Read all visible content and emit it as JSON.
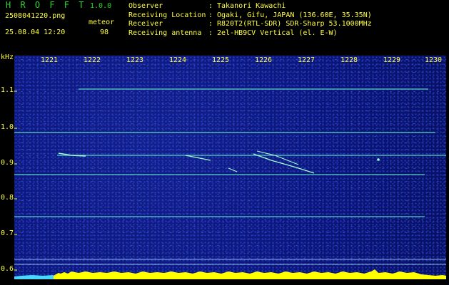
{
  "app": {
    "logo": "H R O F F T",
    "version": "1.0.0",
    "filename": "2508041220.png",
    "meteor_label": "meteor",
    "datetime": "25.08.04 12:20",
    "meteor_count": "98"
  },
  "info": [
    {
      "key": "Observer",
      "value": "Takanori Kawachi"
    },
    {
      "key": "Receiving Location",
      "value": "Ogaki, Gifu, JAPAN (136.60E, 35.35N)"
    },
    {
      "key": "Receiver",
      "value": "R820T2(RTL-SDR) SDR-Sharp 53.1000MHz"
    },
    {
      "key": "Receiving antenna",
      "value": "2el-HB9CV Vertical (el. E-W)"
    }
  ],
  "axes": {
    "y_unit": "kHz",
    "y_ticks": [
      "1.1",
      "1.0",
      "0.9",
      "0.8",
      "0.7",
      "0.6"
    ],
    "x_ticks": [
      "1221",
      "1222",
      "1223",
      "1224",
      "1225",
      "1226",
      "1227",
      "1228",
      "1229",
      "1230"
    ]
  },
  "colors": {
    "background": "#000000",
    "spectrogram": "#0c167a",
    "carrier_line": "#5fe6c8",
    "activity_bar": "#ffff00",
    "axis_text": "#ffff40",
    "logo_text": "#2bd62b"
  }
}
